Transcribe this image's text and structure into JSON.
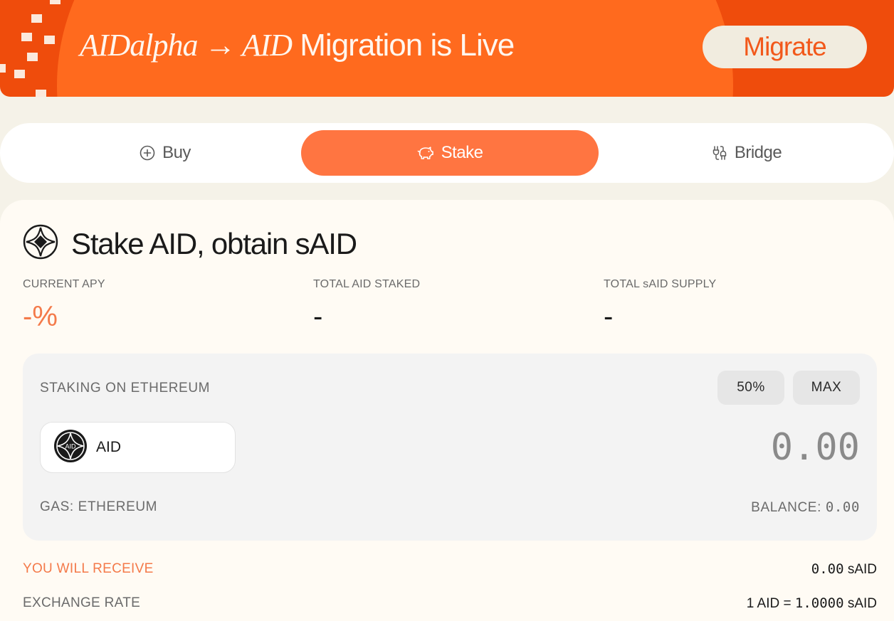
{
  "banner": {
    "italic_text": "AIDalpha → AID",
    "text": "Migration is Live",
    "cta_label": "Migrate"
  },
  "tabs": [
    {
      "label": "Buy",
      "icon": "plus-circle-icon",
      "active": false
    },
    {
      "label": "Stake",
      "icon": "piggy-bank-icon",
      "active": true
    },
    {
      "label": "Bridge",
      "icon": "bridge-icon",
      "active": false
    }
  ],
  "stake": {
    "title": "Stake AID, obtain sAID",
    "title_icon": "aid-logo-icon",
    "stats": [
      {
        "label": "CURRENT APY",
        "value": "-%"
      },
      {
        "label": "TOTAL AID STAKED",
        "value": "-"
      },
      {
        "label": "TOTAL sAID SUPPLY",
        "value": "-"
      }
    ],
    "panel": {
      "label": "STAKING ON ETHEREUM",
      "half_label": "50%",
      "max_label": "MAX",
      "token": "AID",
      "token_logo_text": "AID",
      "amount_placeholder": "0.00",
      "gas_label": "GAS: ETHEREUM",
      "balance_label": "BALANCE:",
      "balance_value": "0.00"
    },
    "receive_label": "YOU WILL RECEIVE",
    "receive_value": "0.00",
    "receive_unit": "sAID",
    "rate_label": "EXCHANGE RATE",
    "rate_prefix": "1 AID =",
    "rate_value": "1.0000",
    "rate_unit": "sAID"
  },
  "colors": {
    "accent": "#ff7541",
    "banner": "#ef4c0c",
    "background": "#f5f2e8"
  }
}
